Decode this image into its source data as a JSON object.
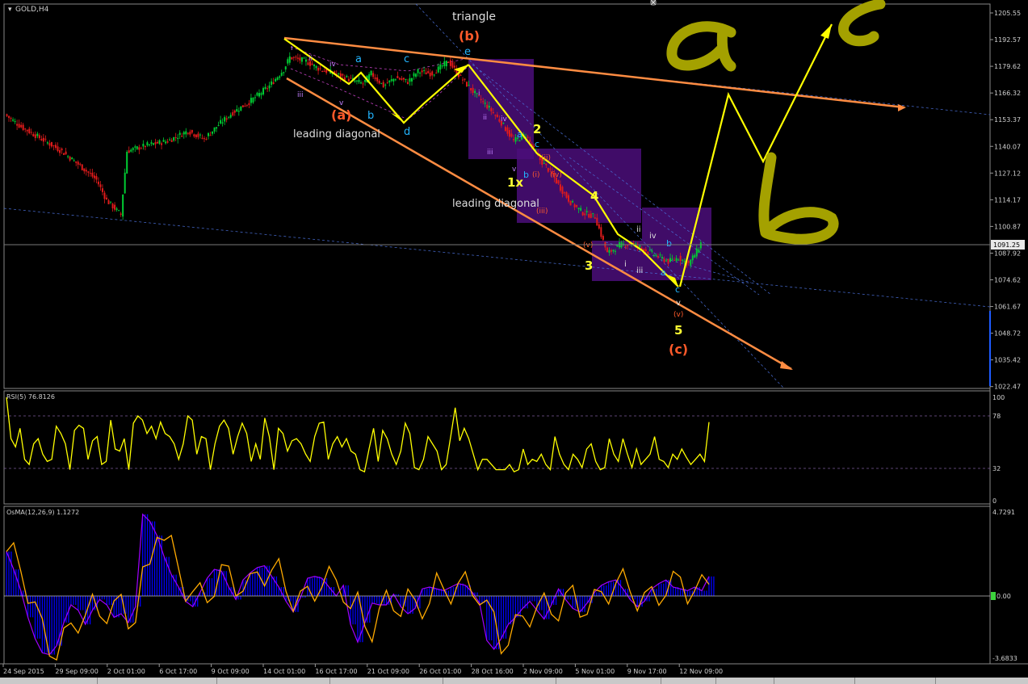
{
  "window": {
    "symbol_label": "GOLD,H4",
    "menu_icon": "triangle-down-icon",
    "close_icon": "close-icon"
  },
  "colors": {
    "background": "#000000",
    "grid": "#1c1c1c",
    "up_candle": "#00cc33",
    "down_candle": "#e01b1b",
    "wave_arrow": "#ffff00",
    "channel": "#ff8c42",
    "fib_line": "#4a6fd8",
    "box": "#4b0e7a",
    "rsi_line": "#ffff00",
    "osma_hist": "#0000ff",
    "osma_signal": "#ffaa00",
    "osma_area": "#a000ff",
    "label_orange": "#ff5a2a",
    "label_cyan": "#22b5ff",
    "label_yellow": "#ffff33",
    "label_violet": "#c080ff",
    "label_white": "#dddddd",
    "handwriting": "#a4a100"
  },
  "price_axis": {
    "ticks": [
      "1205.55",
      "1192.57",
      "1179.62",
      "1166.32",
      "1153.37",
      "1140.07",
      "1127.12",
      "1114.17",
      "1100.87",
      "1087.92",
      "1074.62",
      "1061.67",
      "1048.72",
      "1035.42",
      "1022.47"
    ],
    "current_price": "1091.25"
  },
  "rsi_panel": {
    "title": "RSI(5) 76.8126",
    "ticks": [
      "100",
      "78",
      "32",
      "0"
    ]
  },
  "osma_panel": {
    "title": "OsMA(12,26,9) 1.1272",
    "ticks": [
      "4.7291",
      "0.00",
      "-3.6833"
    ]
  },
  "time_axis": {
    "labels": [
      "24 Sep 2015",
      "29 Sep 09:00",
      "2 Oct 01:00",
      "6 Oct 17:00",
      "9 Oct 09:00",
      "14 Oct 01:00",
      "16 Oct 17:00",
      "21 Oct 09:00",
      "26 Oct 01:00",
      "28 Oct 16:00",
      "2 Nov 09:00",
      "5 Nov 01:00",
      "9 Nov 17:00",
      "12 Nov 09:00"
    ]
  },
  "annotations": {
    "triangle": "triangle",
    "b_paren": "(b)",
    "e_top": "e",
    "a_paren": "(a)",
    "leading_diagonal_1": "leading diagonal",
    "leading_diagonal_2": "leading diagonal",
    "tri_a": "a",
    "tri_b": "b",
    "tri_c": "c",
    "tri_d": "d",
    "i1": "i",
    "ii1": "ii",
    "iii1": "iii",
    "iv1": "iv",
    "v1": "v",
    "w2": "2",
    "w1x": "1x",
    "w3": "3",
    "w4": "4",
    "w5": "5",
    "c_paren": "(c)",
    "sub_i": "(i)",
    "sub_ii": "(ii)",
    "sub_iii": "(iii)",
    "sub_iv": "(iv)",
    "sub_v": "(v)",
    "ld_i": "i",
    "ld_ii": "ii",
    "ld_iii": "iii",
    "ld_iv": "iv",
    "ld_v": "v",
    "ld_a": "a",
    "ld_b": "b",
    "ld_c": "c",
    "end_i": "i",
    "end_ii": "ii",
    "end_iii": "iii",
    "end_iv": "iv",
    "end_v": "v",
    "end_a": "a",
    "end_b": "b",
    "end_c": "c",
    "end_paren_v": "(v)"
  },
  "chart_data": {
    "type": "candlestick",
    "symbol": "GOLD",
    "timeframe": "H4",
    "ylim": [
      1020,
      1208
    ],
    "time_labels": [
      "24 Sep 2015",
      "29 Sep 09:00",
      "2 Oct 01:00",
      "6 Oct 17:00",
      "9 Oct 09:00",
      "14 Oct 01:00",
      "16 Oct 17:00",
      "21 Oct 09:00",
      "26 Oct 01:00",
      "28 Oct 16:00",
      "2 Nov 09:00",
      "5 Nov 01:00",
      "9 Nov 17:00",
      "12 Nov 09:00"
    ],
    "close_path": [
      [
        0,
        1154
      ],
      [
        8,
        1148
      ],
      [
        18,
        1142
      ],
      [
        28,
        1136
      ],
      [
        38,
        1128
      ],
      [
        45,
        1122
      ],
      [
        50,
        1112
      ],
      [
        57,
        1105
      ],
      [
        60,
        1136
      ],
      [
        70,
        1139
      ],
      [
        80,
        1141
      ],
      [
        90,
        1146
      ],
      [
        98,
        1142
      ],
      [
        105,
        1149
      ],
      [
        112,
        1155
      ],
      [
        120,
        1160
      ],
      [
        130,
        1168
      ],
      [
        137,
        1176
      ],
      [
        140,
        1182
      ],
      [
        148,
        1180
      ],
      [
        155,
        1176
      ],
      [
        162,
        1174
      ],
      [
        170,
        1171
      ],
      [
        176,
        1169
      ],
      [
        180,
        1174
      ],
      [
        186,
        1168
      ],
      [
        192,
        1172
      ],
      [
        198,
        1170
      ],
      [
        203,
        1175
      ],
      [
        210,
        1174
      ],
      [
        218,
        1180
      ],
      [
        224,
        1172
      ],
      [
        232,
        1163
      ],
      [
        238,
        1157
      ],
      [
        244,
        1150
      ],
      [
        250,
        1141
      ],
      [
        256,
        1144
      ],
      [
        262,
        1133
      ],
      [
        268,
        1126
      ],
      [
        273,
        1118
      ],
      [
        278,
        1111
      ],
      [
        284,
        1106
      ],
      [
        290,
        1104
      ],
      [
        296,
        1086
      ],
      [
        302,
        1090
      ],
      [
        308,
        1091
      ],
      [
        314,
        1088
      ],
      [
        320,
        1085
      ],
      [
        326,
        1082
      ],
      [
        331,
        1084
      ],
      [
        336,
        1081
      ],
      [
        340,
        1087
      ],
      [
        342,
        1091
      ]
    ],
    "current_price": 1091.25,
    "rsi": {
      "period": 5,
      "value": 76.8126,
      "levels": [
        78,
        32
      ],
      "ylim": [
        0,
        100
      ]
    },
    "osma": {
      "params": [
        12,
        26,
        9
      ],
      "value": 1.1272,
      "ylim": [
        -3.6833,
        4.7291
      ]
    }
  }
}
